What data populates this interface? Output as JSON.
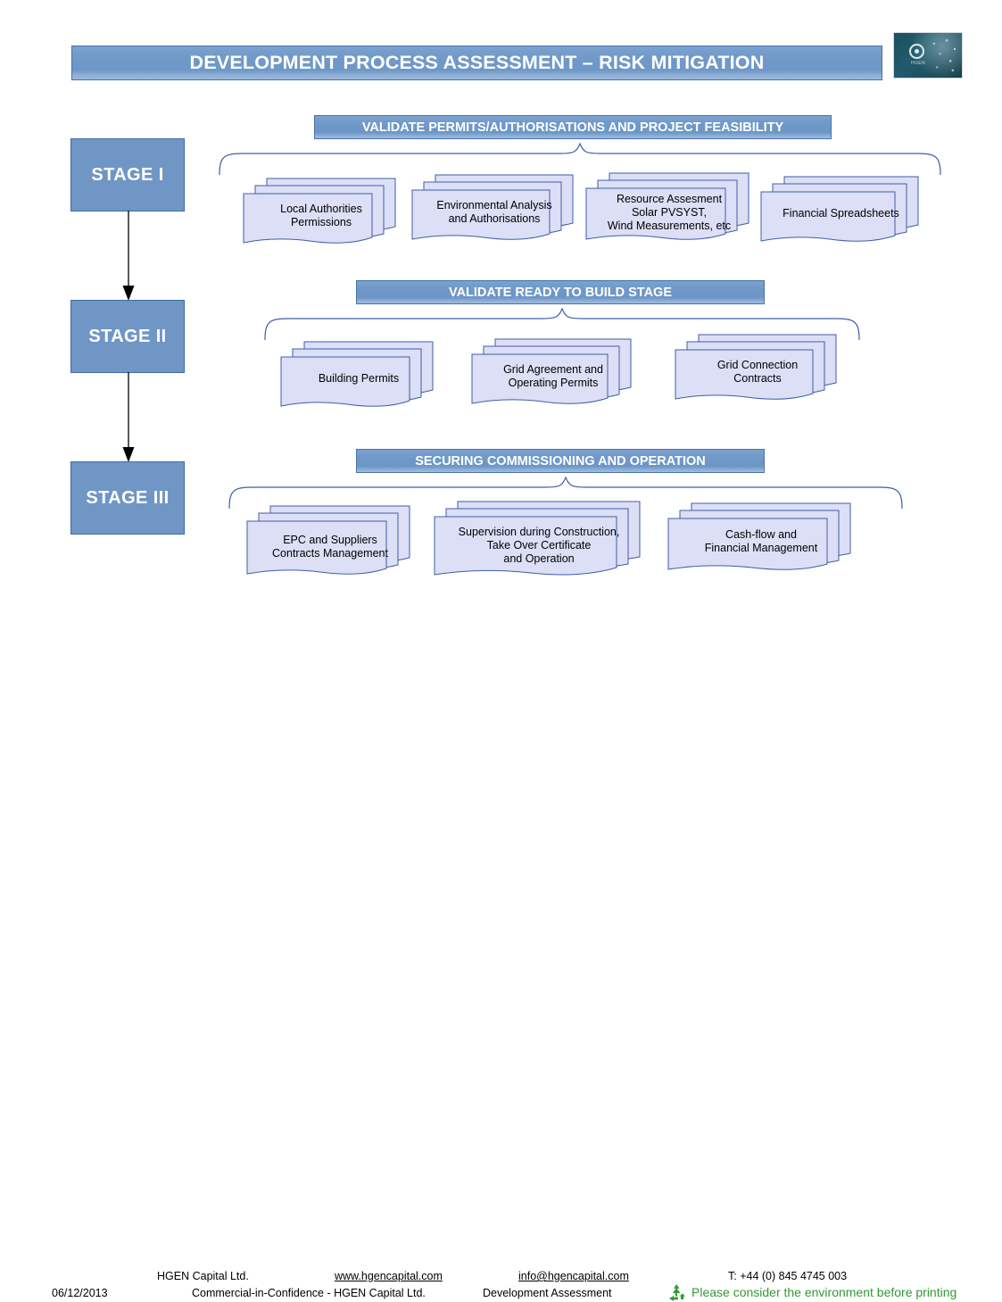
{
  "title": {
    "text": "DEVELOPMENT PROCESS ASSESSMENT – RISK MITIGATION"
  },
  "logo": {
    "name": "hgen-logo",
    "wordmark": "HGEN"
  },
  "colors": {
    "banner_blue": "#7096c5",
    "banner_border": "#4a72a8",
    "stage_fill": "#7096c5",
    "doc_fill": "#dcdff5",
    "doc_border": "#3f5ea8",
    "green_text": "#339933"
  },
  "stages": [
    {
      "label": "STAGE I",
      "banner": "VALIDATE PERMITS/AUTHORISATIONS AND PROJECT FEASIBILITY",
      "documents": [
        "Local Authorities\nPermissions",
        "Environmental Analysis\nand Authorisations",
        "Resource Assesment\nSolar PVSYST,\nWind Measurements, etc",
        "Financial Spreadsheets"
      ]
    },
    {
      "label": "STAGE II",
      "banner": "VALIDATE READY TO BUILD STAGE",
      "documents": [
        "Building Permits",
        "Grid Agreement and\nOperating Permits",
        "Grid Connection\nContracts"
      ]
    },
    {
      "label": "STAGE III",
      "banner": "SECURING COMMISSIONING AND OPERATION",
      "documents": [
        "EPC and Suppliers\nContracts Management",
        "Supervision during Construction,\nTake Over Certificate\nand Operation",
        "Cash-flow and\nFinancial Management"
      ]
    }
  ],
  "footer": {
    "date": "06/12/2013",
    "company": "HGEN Capital Ltd.",
    "website": "www.hgencapital.com",
    "email": "info@hgencapital.com",
    "phone": "T: +44 (0) 845 4745 003",
    "confidentiality": "Commercial-in-Confidence - HGEN Capital Ltd.",
    "doc_title": "Development Assessment",
    "green_notice": "Please consider the environment before printing"
  }
}
